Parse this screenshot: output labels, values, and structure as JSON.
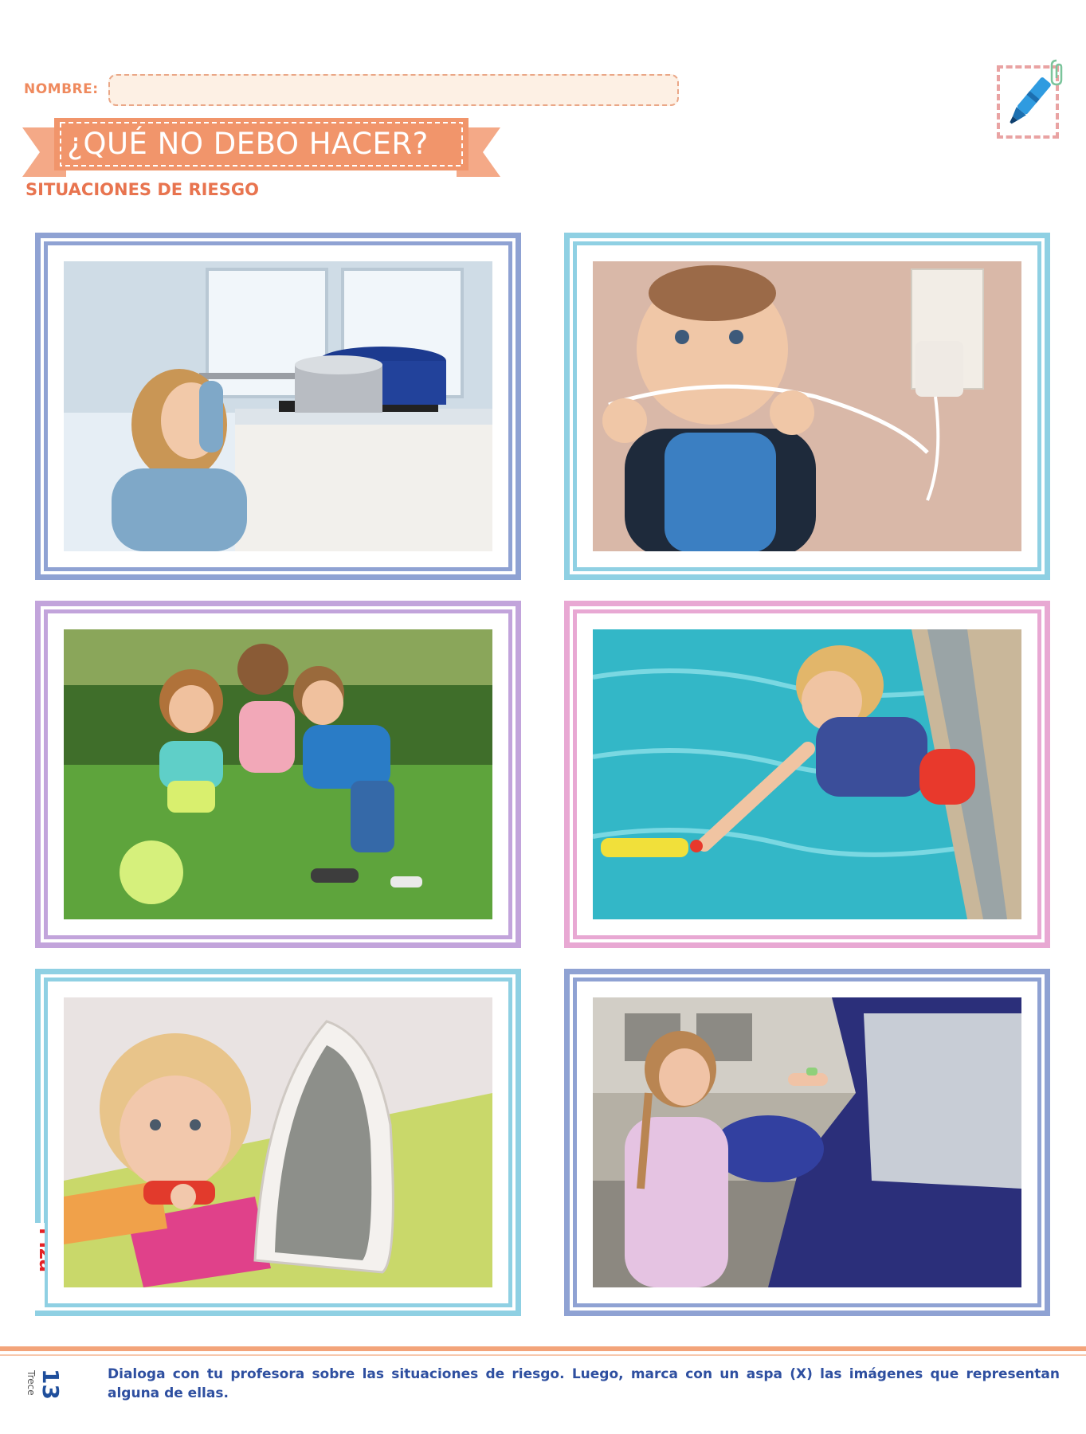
{
  "header": {
    "nombre_label": "NOMBRE:",
    "title": "¿QUÉ NO DEBO HACER?",
    "subtitle": "SITUACIONES DE RIESGO"
  },
  "photos": [
    {
      "scene": "girl-reaching-pot-on-stove"
    },
    {
      "scene": "baby-biting-electric-cord"
    },
    {
      "scene": "children-playing-ball"
    },
    {
      "scene": "child-reaching-toy-in-pool"
    },
    {
      "scene": "toddler-holding-iron"
    },
    {
      "scene": "girl-taking-candy-from-stranger-car"
    }
  ],
  "footer": {
    "page_number": "13",
    "page_word": "Trece",
    "instructions": "Dialoga con tu profesora sobre las situaciones de riesgo. Luego, marca con un aspa (X) las imágenes que representan alguna de ellas."
  },
  "colors": {
    "accent_orange": "#ef8a5e",
    "ribbon": "#f1956b",
    "text_blue": "#2e4fa0"
  },
  "icons": [
    "highlighter-icon",
    "paperclip-icon",
    "logo-mark"
  ]
}
